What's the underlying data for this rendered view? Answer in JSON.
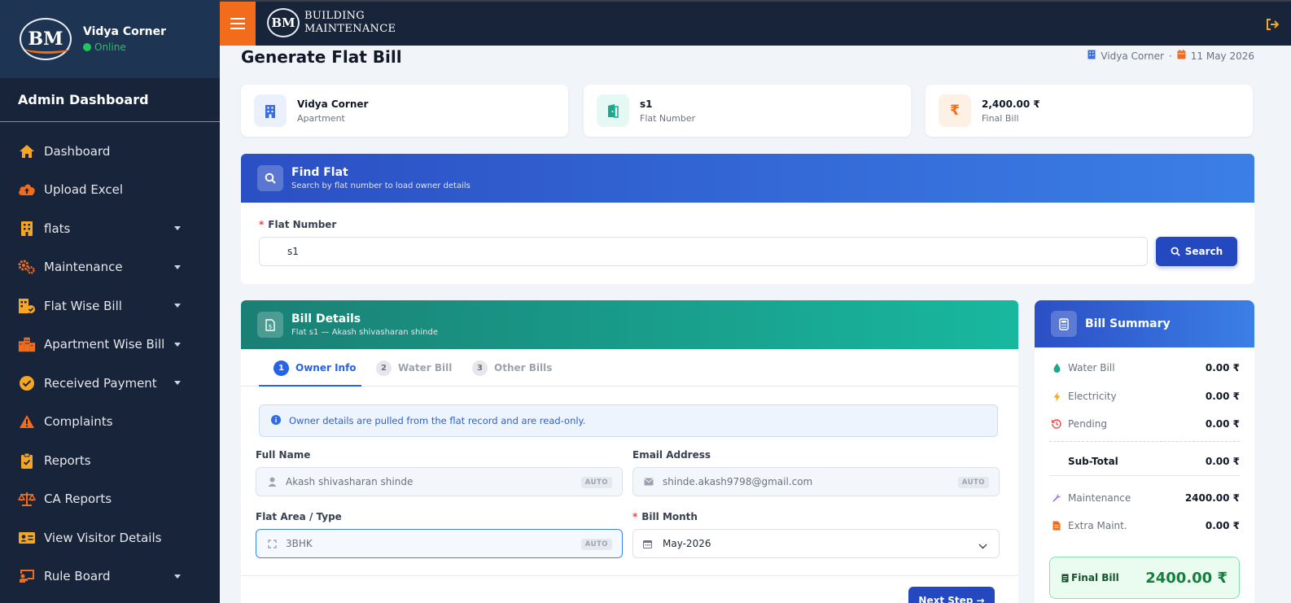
{
  "sidebar": {
    "logo_text": "BM",
    "user_name": "Vidya Corner",
    "status": "Online",
    "section_title": "Admin Dashboard",
    "items": [
      {
        "label": "Dashboard",
        "icon": "home-icon",
        "has_caret": false
      },
      {
        "label": "Upload Excel",
        "icon": "cloud-upload-icon",
        "has_caret": false
      },
      {
        "label": "flats",
        "icon": "building-icon",
        "has_caret": true
      },
      {
        "label": "Maintenance",
        "icon": "gears-icon",
        "has_caret": true
      },
      {
        "label": "Flat Wise Bill",
        "icon": "building-check-icon",
        "has_caret": true
      },
      {
        "label": "Apartment Wise Bill",
        "icon": "city-icon",
        "has_caret": true
      },
      {
        "label": "Received Payment",
        "icon": "check-circle-icon",
        "has_caret": true
      },
      {
        "label": "Complaints",
        "icon": "warning-icon",
        "has_caret": false
      },
      {
        "label": "Reports",
        "icon": "clipboard-check-icon",
        "has_caret": false
      },
      {
        "label": "CA Reports",
        "icon": "scale-icon",
        "has_caret": false
      },
      {
        "label": "View Visitor Details",
        "icon": "id-card-icon",
        "has_caret": false
      },
      {
        "label": "Rule Board",
        "icon": "chalkboard-icon",
        "has_caret": true
      }
    ]
  },
  "topbar": {
    "brand_logo": "BM",
    "brand_line1": "BUILDING",
    "brand_line2": "MAINTENANCE"
  },
  "page": {
    "title": "Generate Flat Bill",
    "meta_apartment": "Vidya Corner",
    "meta_separator": "·",
    "meta_date": "11 May 2026"
  },
  "cards": [
    {
      "main": "Vidya Corner",
      "sub": "Apartment"
    },
    {
      "main": "s1",
      "sub": "Flat Number"
    },
    {
      "main": "2,400.00 ₹",
      "sub": "Final Bill"
    }
  ],
  "find": {
    "title": "Find Flat",
    "subtitle": "Search by flat number to load owner details",
    "field_label": "Flat Number",
    "value": "s1",
    "button": "Search"
  },
  "bill": {
    "title": "Bill Details",
    "subtitle": "Flat s1 — Akash shivasharan shinde",
    "tabs": [
      {
        "num": "1",
        "label": "Owner Info"
      },
      {
        "num": "2",
        "label": "Water Bill"
      },
      {
        "num": "3",
        "label": "Other Bills"
      }
    ],
    "notice": "Owner details are pulled from the flat record and are read-only.",
    "full_name_label": "Full Name",
    "full_name": "Akash shivasharan shinde",
    "email_label": "Email Address",
    "email": "shinde.akash9798@gmail.com",
    "area_label": "Flat Area / Type",
    "area": "3BHK",
    "month_label": "Bill Month",
    "month": "May-2026",
    "auto_badge": "AUTO",
    "next_button": "Next Step →"
  },
  "summary": {
    "title": "Bill Summary",
    "rows": [
      {
        "label": "Water Bill",
        "value": "0.00 ₹"
      },
      {
        "label": "Electricity",
        "value": "0.00 ₹"
      },
      {
        "label": "Pending",
        "value": "0.00 ₹"
      },
      {
        "label": "Sub-Total",
        "value": "0.00 ₹"
      },
      {
        "label": "Maintenance",
        "value": "2400.00 ₹"
      },
      {
        "label": "Extra Maint.",
        "value": "0.00 ₹"
      }
    ],
    "final_label": "Final Bill",
    "final_value": "2400.00 ₹"
  },
  "colors": {
    "accent_orange": "#f26c1c",
    "sidebar_bg": "#17243a",
    "primary_blue": "#2448c0",
    "teal": "#18b89f",
    "final_green": "#15803d"
  }
}
